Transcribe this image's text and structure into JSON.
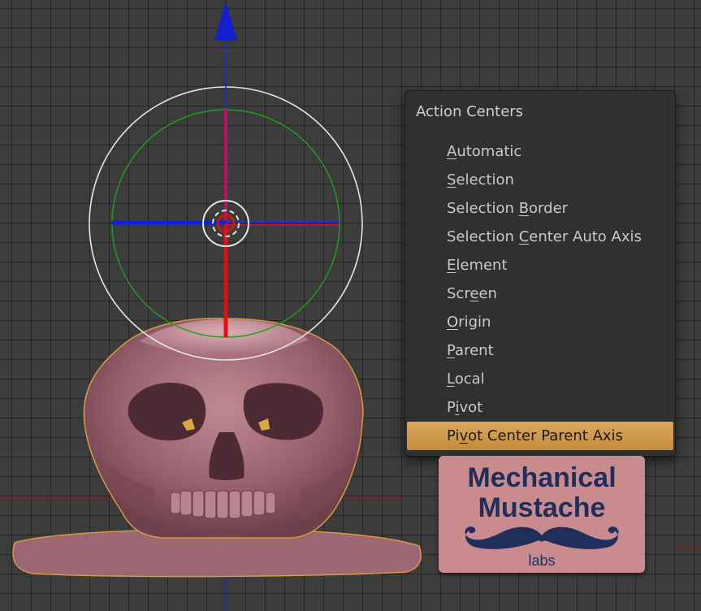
{
  "menu": {
    "title": "Action Centers",
    "items": [
      {
        "label": "Automatic",
        "underline_index": 0,
        "selected": false
      },
      {
        "label": "Selection",
        "underline_index": 0,
        "selected": false
      },
      {
        "label": "Selection Border",
        "underline_index": 10,
        "selected": false
      },
      {
        "label": "Selection Center Auto Axis",
        "underline_index": 10,
        "selected": false
      },
      {
        "label": "Element",
        "underline_index": 0,
        "selected": false
      },
      {
        "label": "Screen",
        "underline_index": 3,
        "selected": false
      },
      {
        "label": "Origin",
        "underline_index": 0,
        "selected": false
      },
      {
        "label": "Parent",
        "underline_index": 0,
        "selected": false
      },
      {
        "label": "Local",
        "underline_index": 0,
        "selected": false
      },
      {
        "label": "Pivot",
        "underline_index": 1,
        "selected": false
      },
      {
        "label": "Pivot Center Parent Axis",
        "underline_index": 2,
        "selected": true
      }
    ]
  },
  "logo": {
    "line1": "Mechanical",
    "line2": "Mustache",
    "line3": "labs"
  },
  "colors": {
    "highlight": "#d2a04f",
    "axis_x": "#e01010",
    "axis_y": "#1020e0",
    "axis_z": "#c01060",
    "ring_outer": "#e6e6e6",
    "ring_inner": "#1fa01f",
    "mesh": "#a86e78",
    "selection_outline": "#d89a40"
  }
}
